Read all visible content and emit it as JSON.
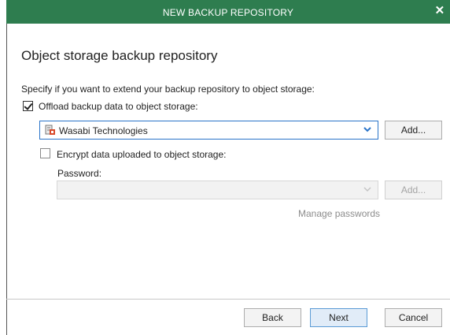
{
  "window": {
    "title": "NEW BACKUP REPOSITORY",
    "close_glyph": "✕"
  },
  "page": {
    "heading": "Object storage backup repository",
    "prompt": "Specify if you want to extend your backup repository to object storage:"
  },
  "offload": {
    "label": "Offload backup data to object storage:",
    "checked": true
  },
  "provider_select": {
    "value": "Wasabi Technologies",
    "icon": "wasabi-storage-icon",
    "add_label": "Add..."
  },
  "encrypt": {
    "label": "Encrypt data uploaded to object storage:",
    "checked": false,
    "password_label": "Password:",
    "password_value": "",
    "add_label": "Add...",
    "manage_link": "Manage passwords"
  },
  "footer": {
    "back_label": "Back",
    "next_label": "Next",
    "cancel_label": "Cancel"
  },
  "colors": {
    "titlebar": "#2e7d4f",
    "focus_border": "#2a74c9"
  }
}
